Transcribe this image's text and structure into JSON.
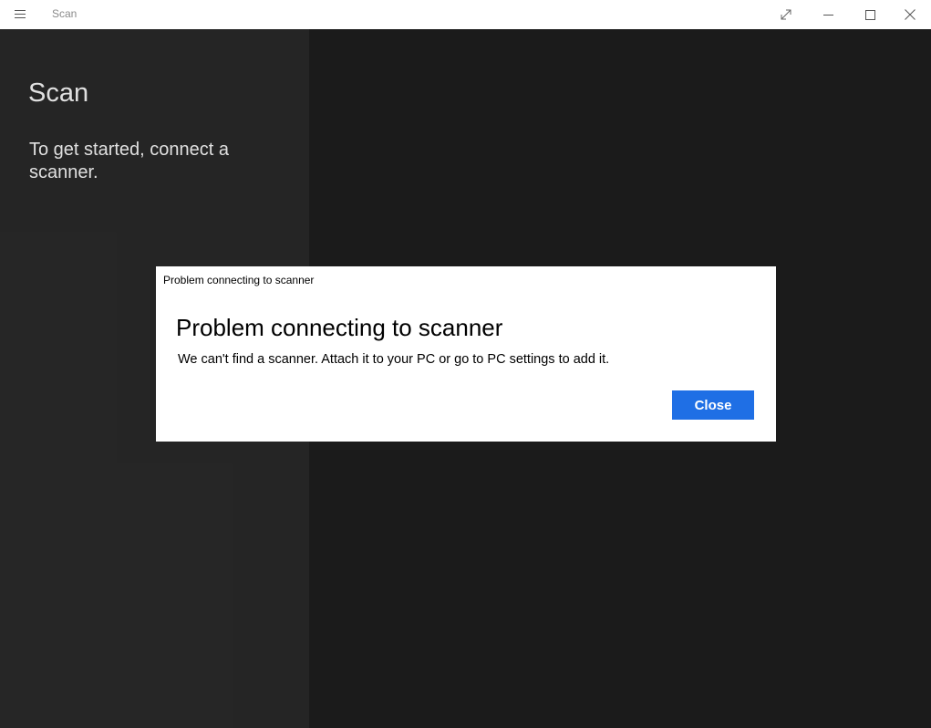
{
  "window": {
    "title": "Scan",
    "menu_icon": "hamburger-icon",
    "controls": {
      "fullscreen_icon": "expand-icon",
      "minimize_icon": "minimize-icon",
      "maximize_icon": "maximize-icon",
      "close_icon": "close-icon"
    }
  },
  "left_pane": {
    "heading": "Scan",
    "message": "To get started, connect a scanner."
  },
  "dialog": {
    "caption": "Problem connecting to scanner",
    "title": "Problem connecting to scanner",
    "message": "We can't find a scanner. Attach it to your PC or go to PC settings to add it.",
    "close_label": "Close"
  },
  "colors": {
    "accent": "#1f6fe5",
    "left_pane_bg": "#2b2b2b",
    "main_pane_bg": "#1f1f1f",
    "titlebar_bg": "#ffffff"
  }
}
